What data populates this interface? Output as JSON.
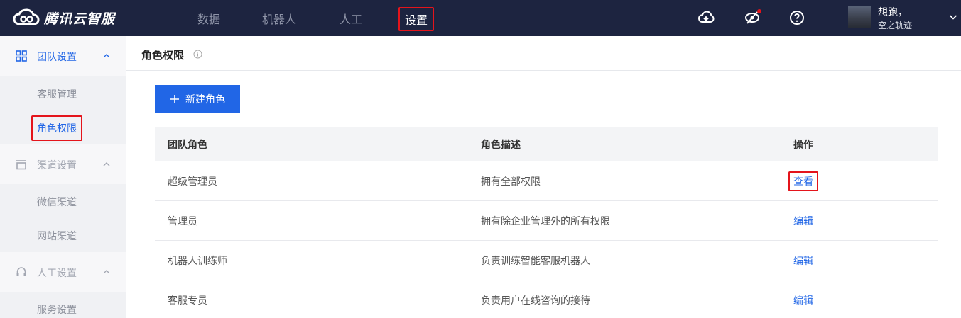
{
  "app": {
    "logo_text": "腾讯云智服"
  },
  "topnav": {
    "items": [
      {
        "label": "数据"
      },
      {
        "label": "机器人"
      },
      {
        "label": "人工"
      },
      {
        "label": "设置",
        "active": true
      }
    ]
  },
  "header_icons": [
    "cloud-upload-icon",
    "eye-off-icon",
    "help-icon"
  ],
  "user": {
    "name": "想跑，",
    "subtitle": "空之轨迹"
  },
  "sidebar": {
    "groups": [
      {
        "label": "团队设置",
        "icon": "grid-icon",
        "expanded": true,
        "items": [
          "客服管理",
          "角色权限"
        ]
      },
      {
        "label": "渠道设置",
        "icon": "window-icon",
        "expanded": true,
        "items": [
          "微信渠道",
          "网站渠道"
        ]
      },
      {
        "label": "人工设置",
        "icon": "headset-icon",
        "expanded": true,
        "items": [
          "服务设置"
        ]
      }
    ],
    "active_item": "角色权限"
  },
  "page": {
    "title": "角色权限",
    "new_button": "新建角色"
  },
  "table": {
    "headers": [
      "团队角色",
      "角色描述",
      "操作"
    ],
    "rows": [
      {
        "role": "超级管理员",
        "desc": "拥有全部权限",
        "action": "查看"
      },
      {
        "role": "管理员",
        "desc": "拥有除企业管理外的所有权限",
        "action": "编辑"
      },
      {
        "role": "机器人训练师",
        "desc": "负责训练智能客服机器人",
        "action": "编辑"
      },
      {
        "role": "客服专员",
        "desc": "负责用户在线咨询的接待",
        "action": "编辑"
      }
    ]
  },
  "colors": {
    "topbar": "#1d2440",
    "accent": "#2166e6",
    "highlight": "#e4141b",
    "sidebar": "#f0f1f4"
  }
}
